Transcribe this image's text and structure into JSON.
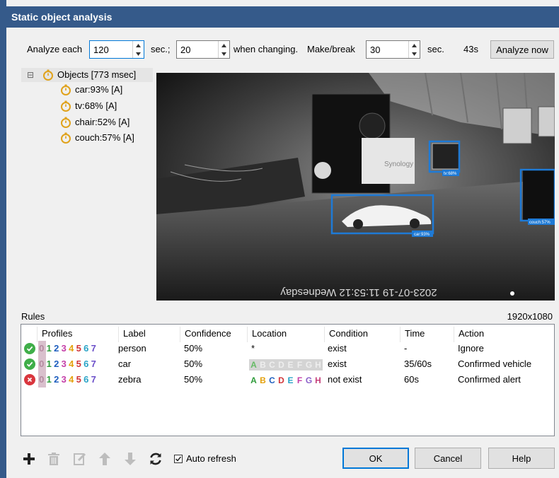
{
  "window": {
    "title": "Static object analysis"
  },
  "toolbar": {
    "analyze_each_label": "Analyze each",
    "analyze_each_value": "120",
    "sec_label": "sec.;",
    "changing_value": "20",
    "when_changing_label": "when changing.",
    "make_break_label": "Make/break",
    "make_break_value": "30",
    "sec_label2": "sec.",
    "countdown": "43s",
    "analyze_now_label": "Analyze now"
  },
  "tree": {
    "root_label": "Objects [773 msec]",
    "collapse_glyph": "⊟",
    "children": [
      {
        "label": "car:93% [A]"
      },
      {
        "label": "tv:68% [A]"
      },
      {
        "label": "chair:52% [A]"
      },
      {
        "label": "couch:57% [A]"
      }
    ]
  },
  "viewer": {
    "timestamp_overlay": "2023-07-19 11:53:12 Wednesday",
    "brand_text": "Synology",
    "detections": [
      {
        "label": "tv:68%"
      },
      {
        "label": "car:93%"
      },
      {
        "label": "couch:57%"
      }
    ],
    "box_color": "#1e7ad6"
  },
  "rules": {
    "label": "Rules",
    "resolution": "1920x1080",
    "headers": {
      "profiles": "Profiles",
      "label": "Label",
      "confidence": "Confidence",
      "location": "Location",
      "condition": "Condition",
      "time": "Time",
      "action": "Action"
    },
    "profile_digits": [
      "0",
      "1",
      "2",
      "3",
      "4",
      "5",
      "6",
      "7"
    ],
    "location_letters": [
      "A",
      "B",
      "C",
      "D",
      "E",
      "F",
      "G",
      "H"
    ],
    "rows": [
      {
        "status": "ok",
        "label": "person",
        "confidence": "50%",
        "location": "*",
        "condition": "exist",
        "time": "-",
        "action": "Ignore"
      },
      {
        "status": "ok",
        "label": "car",
        "confidence": "50%",
        "location": "letters-partial",
        "condition": "exist",
        "time": "35/60s",
        "action": "Confirmed vehicle"
      },
      {
        "status": "error",
        "label": "zebra",
        "confidence": "50%",
        "location": "letters-all",
        "condition": "not exist",
        "time": "60s",
        "action": "Confirmed alert"
      }
    ]
  },
  "bottom": {
    "auto_refresh_label": "Auto refresh",
    "auto_refresh_checked": true,
    "ok_label": "OK",
    "cancel_label": "Cancel",
    "help_label": "Help"
  },
  "colors": {
    "title_bar": "#355a8a",
    "accent": "#0078d7",
    "ok_green": "#3fae49",
    "error_red": "#d9363e",
    "digit_colors": [
      "#b48aa0",
      "#2e9b3a",
      "#1f5fbf",
      "#c53fa8",
      "#e4a10c",
      "#d13438",
      "#2aa4c7",
      "#6b4fc9"
    ],
    "letter_colors": [
      "#2e9b3a",
      "#e4a10c",
      "#1f5fbf",
      "#d13438",
      "#2aa4c7",
      "#c53fa8",
      "#8b5fc9",
      "#c53f7a"
    ]
  }
}
